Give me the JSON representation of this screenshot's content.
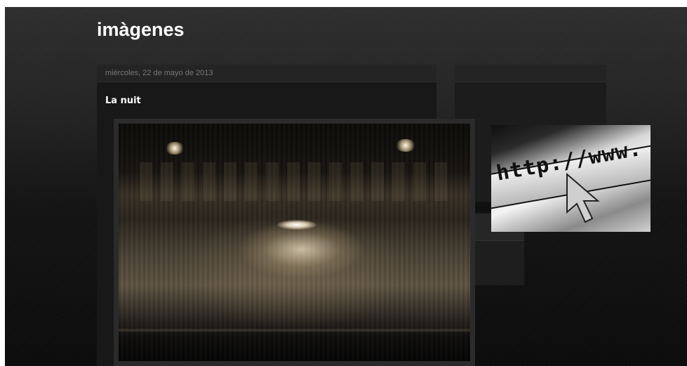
{
  "blog": {
    "title": "imàgenes"
  },
  "post": {
    "date": "miércoles, 22 de mayo de 2013",
    "title": "La nuit"
  },
  "sidebar": {
    "image_text": "http://www."
  }
}
